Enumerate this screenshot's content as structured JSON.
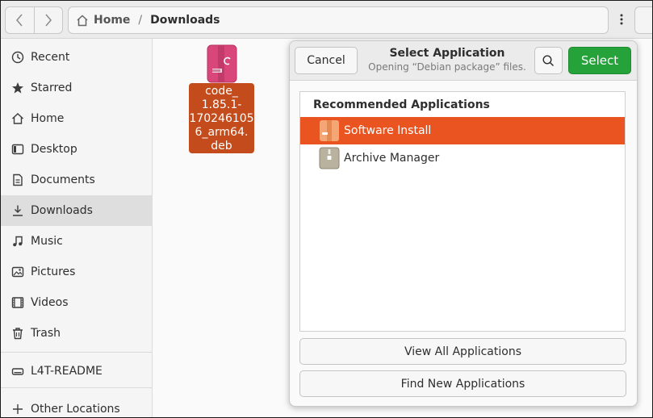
{
  "headerbar": {
    "back_icon": "chevron-left-icon",
    "forward_icon": "chevron-right-icon",
    "breadcrumb": {
      "home_label": "Home",
      "separator": "/",
      "current": "Downloads"
    },
    "menu_icon": "kebab-menu-icon"
  },
  "sidebar": {
    "items": [
      {
        "label": "Recent",
        "icon": "clock-icon"
      },
      {
        "label": "Starred",
        "icon": "star-icon"
      },
      {
        "label": "Home",
        "icon": "home-icon"
      },
      {
        "label": "Desktop",
        "icon": "desktop-icon"
      },
      {
        "label": "Documents",
        "icon": "document-icon"
      },
      {
        "label": "Downloads",
        "icon": "download-icon",
        "active": true
      },
      {
        "label": "Music",
        "icon": "music-icon"
      },
      {
        "label": "Pictures",
        "icon": "picture-icon"
      },
      {
        "label": "Videos",
        "icon": "video-icon"
      },
      {
        "label": "Trash",
        "icon": "trash-icon"
      },
      {
        "label": "L4T-README",
        "icon": "drive-icon"
      },
      {
        "label": "Other Locations",
        "icon": "plus-icon"
      }
    ]
  },
  "files": [
    {
      "name_lines": [
        "code_",
        "1.85.1-",
        "170246105",
        "6_arm64.",
        "deb"
      ],
      "icon": "debian-package-icon",
      "selected": true
    }
  ],
  "dialog": {
    "title": "Select Application",
    "subtitle": "Opening “Debian package” files.",
    "cancel_label": "Cancel",
    "select_label": "Select",
    "search_icon": "search-icon",
    "list_header": "Recommended Applications",
    "apps": [
      {
        "label": "Software Install",
        "icon": "software-install-icon",
        "selected": true
      },
      {
        "label": "Archive Manager",
        "icon": "archive-manager-icon",
        "selected": false
      }
    ],
    "view_all_label": "View All Applications",
    "find_new_label": "Find New Applications"
  },
  "colors": {
    "accent": "#e95420",
    "selected_file_bg": "#c34b1c",
    "select_button": "#26a23a",
    "package_icon": "#d9467a"
  }
}
